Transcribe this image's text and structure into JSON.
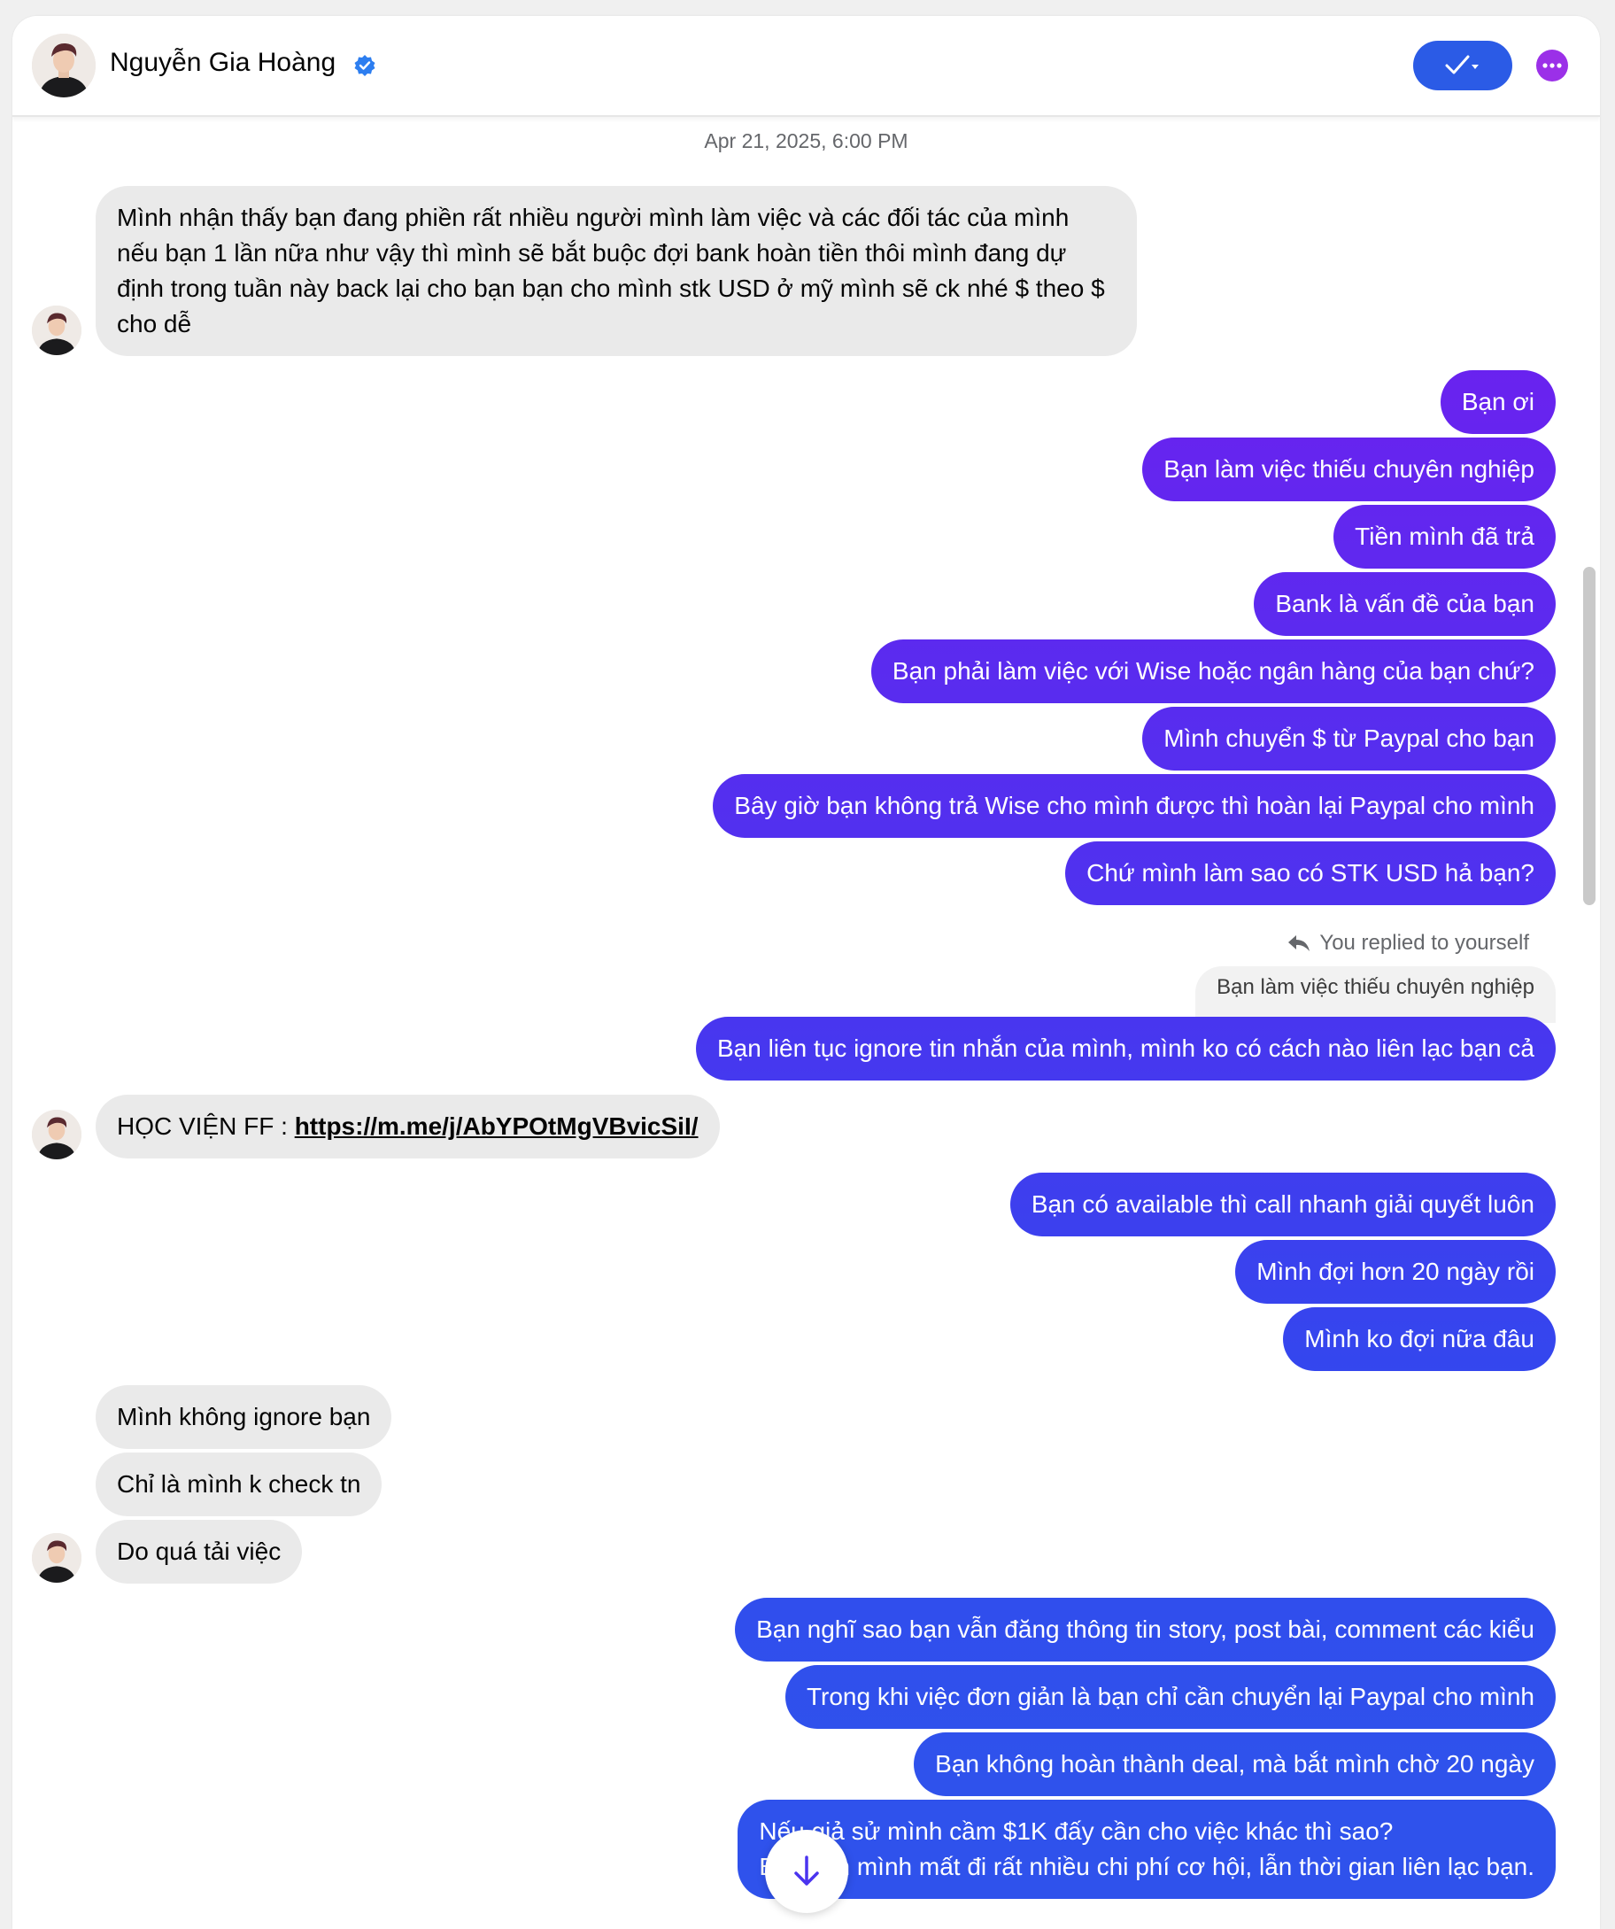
{
  "header": {
    "contact_name": "Nguyễn Gia Hoàng",
    "verified_icon": "verified-badge-icon",
    "mark_done_icon": "check-dropdown-icon",
    "more_icon": "more-options-icon"
  },
  "conversation": {
    "timestamp": "Apr 21, 2025, 6:00 PM",
    "messages": [
      {
        "from": "them",
        "text": "Mình nhận thấy bạn đang phiền rất nhiều người mình làm việc và các đối tác của mình nếu bạn 1 lần nữa như vậy thì mình sẽ bắt buộc đợi bank hoàn tiền thôi mình đang dự định trong tuần này back lại cho bạn bạn cho mình stk USD ở mỹ mình sẽ ck nhé $ theo $ cho dễ"
      },
      {
        "from": "me",
        "text": "Bạn ơi"
      },
      {
        "from": "me",
        "text": "Bạn làm việc thiếu chuyên nghiệp"
      },
      {
        "from": "me",
        "text": "Tiền mình đã trả"
      },
      {
        "from": "me",
        "text": "Bank là vấn đề của bạn"
      },
      {
        "from": "me",
        "text": "Bạn phải làm việc với Wise hoặc ngân hàng của bạn chứ?"
      },
      {
        "from": "me",
        "text": "Mình chuyển $ từ Paypal cho bạn"
      },
      {
        "from": "me",
        "text": "Bây giờ bạn không trả Wise cho mình được thì hoàn lại Paypal cho mình"
      },
      {
        "from": "me",
        "text": "Chứ mình làm sao có STK USD hả bạn?"
      },
      {
        "from": "me",
        "text": "Bạn liên tục ignore tin nhắn của mình, mình ko có cách nào liên lạc bạn cả"
      },
      {
        "from": "them",
        "text": "HỌC VIỆN FF : ",
        "link": "https://m.me/j/AbYPOtMgVBvicSiI/"
      },
      {
        "from": "me",
        "text": "Bạn có available thì call nhanh giải quyết luôn"
      },
      {
        "from": "me",
        "text": "Mình đợi hơn 20 ngày rồi"
      },
      {
        "from": "me",
        "text": "Mình ko đợi nữa đâu"
      },
      {
        "from": "them",
        "text": "Mình không ignore bạn"
      },
      {
        "from": "them",
        "text": "Chỉ là mình k check tn"
      },
      {
        "from": "them",
        "text": "Do quá tải việc"
      },
      {
        "from": "me",
        "text": "Bạn nghĩ sao bạn vẫn đăng thông tin story, post bài, comment các kiểu"
      },
      {
        "from": "me",
        "text": "Trong khi việc đơn giản là bạn chỉ cần chuyển lại Paypal cho mình"
      },
      {
        "from": "me",
        "text": "Bạn không hoàn thành deal, mà bắt mình chờ 20 ngày"
      },
      {
        "from": "me",
        "line1": "Nếu giả sử mình cầm $1K đấy cần cho việc khác thì sao?",
        "line2": "Bạn làm mình mất đi rất nhiều chi phí cơ hội, lẫn thời gian liên lạc bạn."
      }
    ],
    "reply_note": "You replied to yourself",
    "quoted_text": "Bạn làm việc thiếu chuyên nghiệp",
    "reply_icon": "reply-arrow-icon",
    "scroll_down_icon": "arrow-down-icon"
  }
}
